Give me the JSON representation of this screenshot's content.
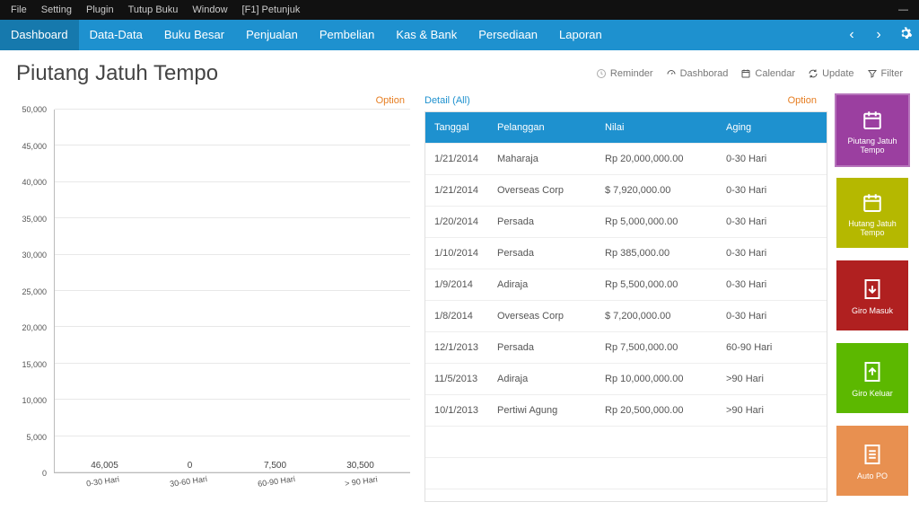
{
  "titlebar": {
    "items": [
      "File",
      "Setting",
      "Plugin",
      "Tutup Buku",
      "Window",
      "[F1] Petunjuk"
    ]
  },
  "menubar": {
    "items": [
      "Dashboard",
      "Data-Data",
      "Buku Besar",
      "Penjualan",
      "Pembelian",
      "Kas & Bank",
      "Persediaan",
      "Laporan"
    ],
    "active": 0
  },
  "page": {
    "title": "Piutang Jatuh Tempo"
  },
  "tools": [
    "Reminder",
    "Dashborad",
    "Calendar",
    "Update",
    "Filter"
  ],
  "chart": {
    "option": "Option"
  },
  "chart_data": {
    "type": "bar",
    "categories": [
      "0-30 Hari",
      "30-60 Hari",
      "60-90 Hari",
      "> 90 Hari"
    ],
    "values": [
      46005,
      0,
      7500,
      30500
    ],
    "colors": [
      "#3498db",
      "#3498db",
      "#c0392b",
      "#27ae60"
    ],
    "ylim": [
      0,
      50000
    ],
    "ytick": 5000,
    "title": "",
    "xlabel": "",
    "ylabel": ""
  },
  "detail": {
    "label": "Detail (All)",
    "option": "Option",
    "columns": [
      "Tanggal",
      "Pelanggan",
      "Nilai",
      "Aging"
    ],
    "rows": [
      {
        "t": "1/21/2014",
        "p": "Maharaja",
        "n": "Rp 20,000,000.00",
        "a": "0-30 Hari"
      },
      {
        "t": "1/21/2014",
        "p": "Overseas Corp",
        "n": "$ 7,920,000.00",
        "a": "0-30 Hari"
      },
      {
        "t": "1/20/2014",
        "p": "Persada",
        "n": "Rp 5,000,000.00",
        "a": "0-30 Hari"
      },
      {
        "t": "1/10/2014",
        "p": "Persada",
        "n": "Rp 385,000.00",
        "a": "0-30 Hari"
      },
      {
        "t": "1/9/2014",
        "p": "Adiraja",
        "n": "Rp 5,500,000.00",
        "a": "0-30 Hari"
      },
      {
        "t": "1/8/2014",
        "p": "Overseas Corp",
        "n": "$ 7,200,000.00",
        "a": "0-30 Hari"
      },
      {
        "t": "12/1/2013",
        "p": "Persada",
        "n": "Rp 7,500,000.00",
        "a": "60-90 Hari"
      },
      {
        "t": "11/5/2013",
        "p": "Adiraja",
        "n": "Rp 10,000,000.00",
        "a": ">90 Hari"
      },
      {
        "t": "10/1/2013",
        "p": "Pertiwi Agung",
        "n": "Rp 20,500,000.00",
        "a": ">90 Hari"
      }
    ]
  },
  "tiles": [
    {
      "label": "Piutang Jatuh Tempo"
    },
    {
      "label": "Hutang Jatuh Tempo"
    },
    {
      "label": "Giro Masuk"
    },
    {
      "label": "Giro Keluar"
    },
    {
      "label": "Auto PO"
    }
  ]
}
